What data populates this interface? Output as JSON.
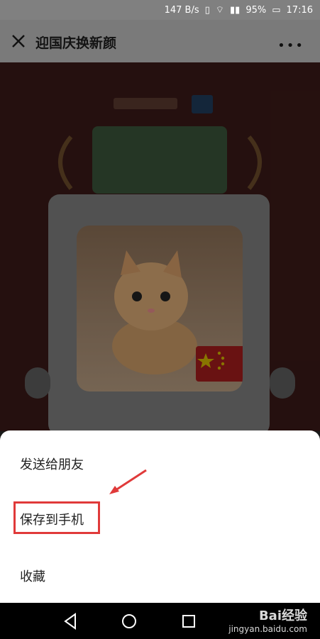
{
  "status_bar": {
    "speed": "147 B/s",
    "battery": "95%",
    "time": "17:16"
  },
  "header": {
    "title": "迎国庆换新颜"
  },
  "sheet": {
    "options": [
      {
        "label": "发送给朋友"
      },
      {
        "label": "保存到手机"
      },
      {
        "label": "收藏"
      }
    ]
  },
  "watermark": {
    "brand": "Bai经验",
    "url": "jingyan.baidu.com"
  },
  "colors": {
    "highlight": "#e03a3a",
    "sheet_bg": "#ffffff"
  }
}
